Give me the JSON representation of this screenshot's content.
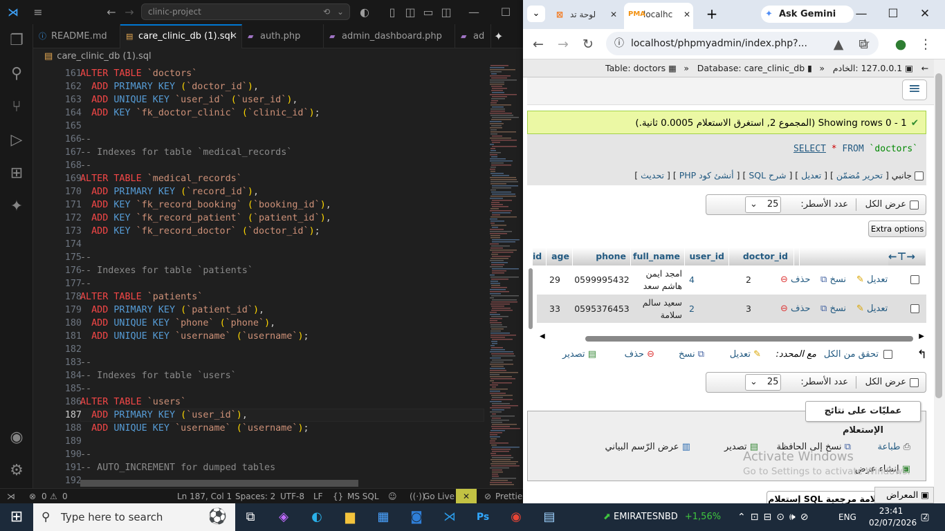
{
  "vscode": {
    "search_text": "clinic-project",
    "tabs": [
      {
        "label": "README.md",
        "icon": "info-icon",
        "icon_glyph": "ⓘ"
      },
      {
        "label": "care_clinic_db (1).sql",
        "icon": "database-icon",
        "icon_glyph": "▤"
      },
      {
        "label": "auth.php",
        "icon": "php-icon",
        "icon_glyph": "▰"
      },
      {
        "label": "admin_dashboard.php",
        "icon": "php-icon",
        "icon_glyph": "▰"
      },
      {
        "label": "ad",
        "icon": "php-icon",
        "icon_glyph": "▰"
      }
    ],
    "breadcrumb": "care_clinic_db (1).sql",
    "current_line": "187",
    "lines": [
      {
        "n": "161",
        "parts": [
          [
            "kw",
            "ALTER TABLE "
          ],
          [
            "st",
            "`doctors`"
          ]
        ]
      },
      {
        "n": "162",
        "parts": [
          [
            "t",
            "  "
          ],
          [
            "kw",
            "ADD "
          ],
          [
            "kb",
            "PRIMARY KEY "
          ],
          [
            "pn",
            "("
          ],
          [
            "st",
            "`doctor_id`"
          ],
          [
            "pn",
            ")"
          ],
          [
            "t",
            ","
          ]
        ]
      },
      {
        "n": "163",
        "parts": [
          [
            "t",
            "  "
          ],
          [
            "kw",
            "ADD "
          ],
          [
            "kb",
            "UNIQUE KEY "
          ],
          [
            "st",
            "`user_id` "
          ],
          [
            "pn",
            "("
          ],
          [
            "st",
            "`user_id`"
          ],
          [
            "pn",
            ")"
          ],
          [
            "t",
            ","
          ]
        ]
      },
      {
        "n": "164",
        "parts": [
          [
            "t",
            "  "
          ],
          [
            "kw",
            "ADD "
          ],
          [
            "kb",
            "KEY "
          ],
          [
            "st",
            "`fk_doctor_clinic` "
          ],
          [
            "pn",
            "("
          ],
          [
            "st",
            "`clinic_id`"
          ],
          [
            "pn",
            ")"
          ],
          [
            "t",
            ";"
          ]
        ]
      },
      {
        "n": "165",
        "parts": []
      },
      {
        "n": "166",
        "parts": [
          [
            "cm",
            "--"
          ]
        ]
      },
      {
        "n": "167",
        "parts": [
          [
            "cm",
            "-- Indexes for table `medical_records`"
          ]
        ]
      },
      {
        "n": "168",
        "parts": [
          [
            "cm",
            "--"
          ]
        ]
      },
      {
        "n": "169",
        "parts": [
          [
            "kw",
            "ALTER TABLE "
          ],
          [
            "st",
            "`medical_records`"
          ]
        ]
      },
      {
        "n": "170",
        "parts": [
          [
            "t",
            "  "
          ],
          [
            "kw",
            "ADD "
          ],
          [
            "kb",
            "PRIMARY KEY "
          ],
          [
            "pn",
            "("
          ],
          [
            "st",
            "`record_id`"
          ],
          [
            "pn",
            ")"
          ],
          [
            "t",
            ","
          ]
        ]
      },
      {
        "n": "171",
        "parts": [
          [
            "t",
            "  "
          ],
          [
            "kw",
            "ADD "
          ],
          [
            "kb",
            "KEY "
          ],
          [
            "st",
            "`fk_record_booking` "
          ],
          [
            "pn",
            "("
          ],
          [
            "st",
            "`booking_id`"
          ],
          [
            "pn",
            ")"
          ],
          [
            "t",
            ","
          ]
        ]
      },
      {
        "n": "172",
        "parts": [
          [
            "t",
            "  "
          ],
          [
            "kw",
            "ADD "
          ],
          [
            "kb",
            "KEY "
          ],
          [
            "st",
            "`fk_record_patient` "
          ],
          [
            "pn",
            "("
          ],
          [
            "st",
            "`patient_id`"
          ],
          [
            "pn",
            ")"
          ],
          [
            "t",
            ","
          ]
        ]
      },
      {
        "n": "173",
        "parts": [
          [
            "t",
            "  "
          ],
          [
            "kw",
            "ADD "
          ],
          [
            "kb",
            "KEY "
          ],
          [
            "st",
            "`fk_record_doctor` "
          ],
          [
            "pn",
            "("
          ],
          [
            "st",
            "`doctor_id`"
          ],
          [
            "pn",
            ")"
          ],
          [
            "t",
            ";"
          ]
        ]
      },
      {
        "n": "174",
        "parts": []
      },
      {
        "n": "175",
        "parts": [
          [
            "cm",
            "--"
          ]
        ]
      },
      {
        "n": "176",
        "parts": [
          [
            "cm",
            "-- Indexes for table `patients`"
          ]
        ]
      },
      {
        "n": "177",
        "parts": [
          [
            "cm",
            "--"
          ]
        ]
      },
      {
        "n": "178",
        "parts": [
          [
            "kw",
            "ALTER TABLE "
          ],
          [
            "st",
            "`patients`"
          ]
        ]
      },
      {
        "n": "179",
        "parts": [
          [
            "t",
            "  "
          ],
          [
            "kw",
            "ADD "
          ],
          [
            "kb",
            "PRIMARY KEY "
          ],
          [
            "pn",
            "("
          ],
          [
            "st",
            "`patient_id`"
          ],
          [
            "pn",
            ")"
          ],
          [
            "t",
            ","
          ]
        ]
      },
      {
        "n": "180",
        "parts": [
          [
            "t",
            "  "
          ],
          [
            "kw",
            "ADD "
          ],
          [
            "kb",
            "UNIQUE KEY "
          ],
          [
            "st",
            "`phone` "
          ],
          [
            "pn",
            "("
          ],
          [
            "st",
            "`phone`"
          ],
          [
            "pn",
            ")"
          ],
          [
            "t",
            ","
          ]
        ]
      },
      {
        "n": "181",
        "parts": [
          [
            "t",
            "  "
          ],
          [
            "kw",
            "ADD "
          ],
          [
            "kb",
            "UNIQUE KEY "
          ],
          [
            "st",
            "`username` "
          ],
          [
            "pn",
            "("
          ],
          [
            "st",
            "`username`"
          ],
          [
            "pn",
            ")"
          ],
          [
            "t",
            ";"
          ]
        ]
      },
      {
        "n": "182",
        "parts": []
      },
      {
        "n": "183",
        "parts": [
          [
            "cm",
            "--"
          ]
        ]
      },
      {
        "n": "184",
        "parts": [
          [
            "cm",
            "-- Indexes for table `users`"
          ]
        ]
      },
      {
        "n": "185",
        "parts": [
          [
            "cm",
            "--"
          ]
        ]
      },
      {
        "n": "186",
        "parts": [
          [
            "kw",
            "ALTER TABLE "
          ],
          [
            "st",
            "`users`"
          ]
        ]
      },
      {
        "n": "187",
        "parts": [
          [
            "t",
            "  "
          ],
          [
            "kw",
            "ADD "
          ],
          [
            "kb",
            "PRIMARY KEY "
          ],
          [
            "pn",
            "("
          ],
          [
            "st",
            "`user_id`"
          ],
          [
            "pn",
            ")"
          ],
          [
            "t",
            ","
          ]
        ]
      },
      {
        "n": "188",
        "parts": [
          [
            "t",
            "  "
          ],
          [
            "kw",
            "ADD "
          ],
          [
            "kb",
            "UNIQUE KEY "
          ],
          [
            "st",
            "`username` "
          ],
          [
            "pn",
            "("
          ],
          [
            "st",
            "`username`"
          ],
          [
            "pn",
            ")"
          ],
          [
            "t",
            ";"
          ]
        ]
      },
      {
        "n": "189",
        "parts": []
      },
      {
        "n": "190",
        "parts": [
          [
            "cm",
            "--"
          ]
        ]
      },
      {
        "n": "191",
        "parts": [
          [
            "cm",
            "-- AUTO_INCREMENT for dumped tables"
          ]
        ]
      },
      {
        "n": "192",
        "parts": [
          [
            "cm",
            "--"
          ]
        ]
      }
    ],
    "status": {
      "errors": "0",
      "warnings": "0",
      "position": "Ln 187, Col 1",
      "spaces": "Spaces: 2",
      "encoding": "UTF-8",
      "eol": "LF",
      "language": "MS SQL",
      "golive": "Go Live",
      "prettier": "Prettier"
    }
  },
  "browser": {
    "tabs": [
      {
        "label": "لوحة تد",
        "icon": "xampp-icon"
      },
      {
        "label": "localhc",
        "icon": "pma-icon"
      }
    ],
    "gemini": "Ask Gemini",
    "url": "localhost/phpmyadmin/index.php?...",
    "breadcrumb": {
      "server": "127.0.0.1 :الخادم",
      "database": "Database: care_clinic_db",
      "table": "Table: doctors"
    },
    "success": "Showing rows 0 - 1 (المجموع 2, استغرق الاستعلام 0.0005 ثانية.)",
    "sql": {
      "kw1": "SELECT",
      "star": "*",
      "kw2": "FROM",
      "table": "`doctors`"
    },
    "sql_links": {
      "inline": "جانبي",
      "edit_inline": "تحرير مُضمّن",
      "edit": "تعديل",
      "explain": "شرح SQL",
      "php": "أنشئ كود PHP",
      "refresh": "تحديث"
    },
    "nav": {
      "show_all": "عرض الكل",
      "rows_label": "عدد الأسطر:",
      "rows_value": "25"
    },
    "extra_options": "Extra options",
    "columns": [
      "doctor_id",
      "user_id",
      "full_name",
      "phone",
      "age",
      "id"
    ],
    "rows": [
      {
        "doctor_id": "2",
        "user_id": "4",
        "full_name_1": "امجد  ايمن",
        "full_name_2": "هاشم سعد",
        "phone": "0599995432",
        "age": "29"
      },
      {
        "doctor_id": "3",
        "user_id": "2",
        "full_name_1": "سعيد سالم",
        "full_name_2": "سلامة",
        "phone": "0595376453",
        "age": "33"
      }
    ],
    "row_actions": {
      "edit": "تعديل",
      "copy": "نسخ",
      "delete": "حذف"
    },
    "bulk": {
      "check_all": "تحقق من الكل",
      "with_selected": "مع المحدد:",
      "edit": "تعديل",
      "copy": "نسخ",
      "delete": "حذف",
      "export": "تصدير"
    },
    "ops": {
      "title": "عمليّات على نتائج الإستعلام",
      "print": "طباعة",
      "clipboard": "نسخ إلى الحافظة",
      "export": "تصدير",
      "chart": "عرض الرّسم البياني",
      "create_view": "إنشاء عرض"
    },
    "watermark": {
      "line1": "Activate Windows",
      "line2": "Go to Settings to activate Windows."
    },
    "console": "المعراض",
    "bottom_partial": "علامة مرجعية SQL إستعلام"
  },
  "taskbar": {
    "search_placeholder": "Type here to search",
    "ticker_name": "EMIRATESNBD",
    "ticker_value": "+1,56%",
    "lang": "ENG",
    "time": "23:41",
    "date": "02/07/2026",
    "notif_count": "2"
  }
}
